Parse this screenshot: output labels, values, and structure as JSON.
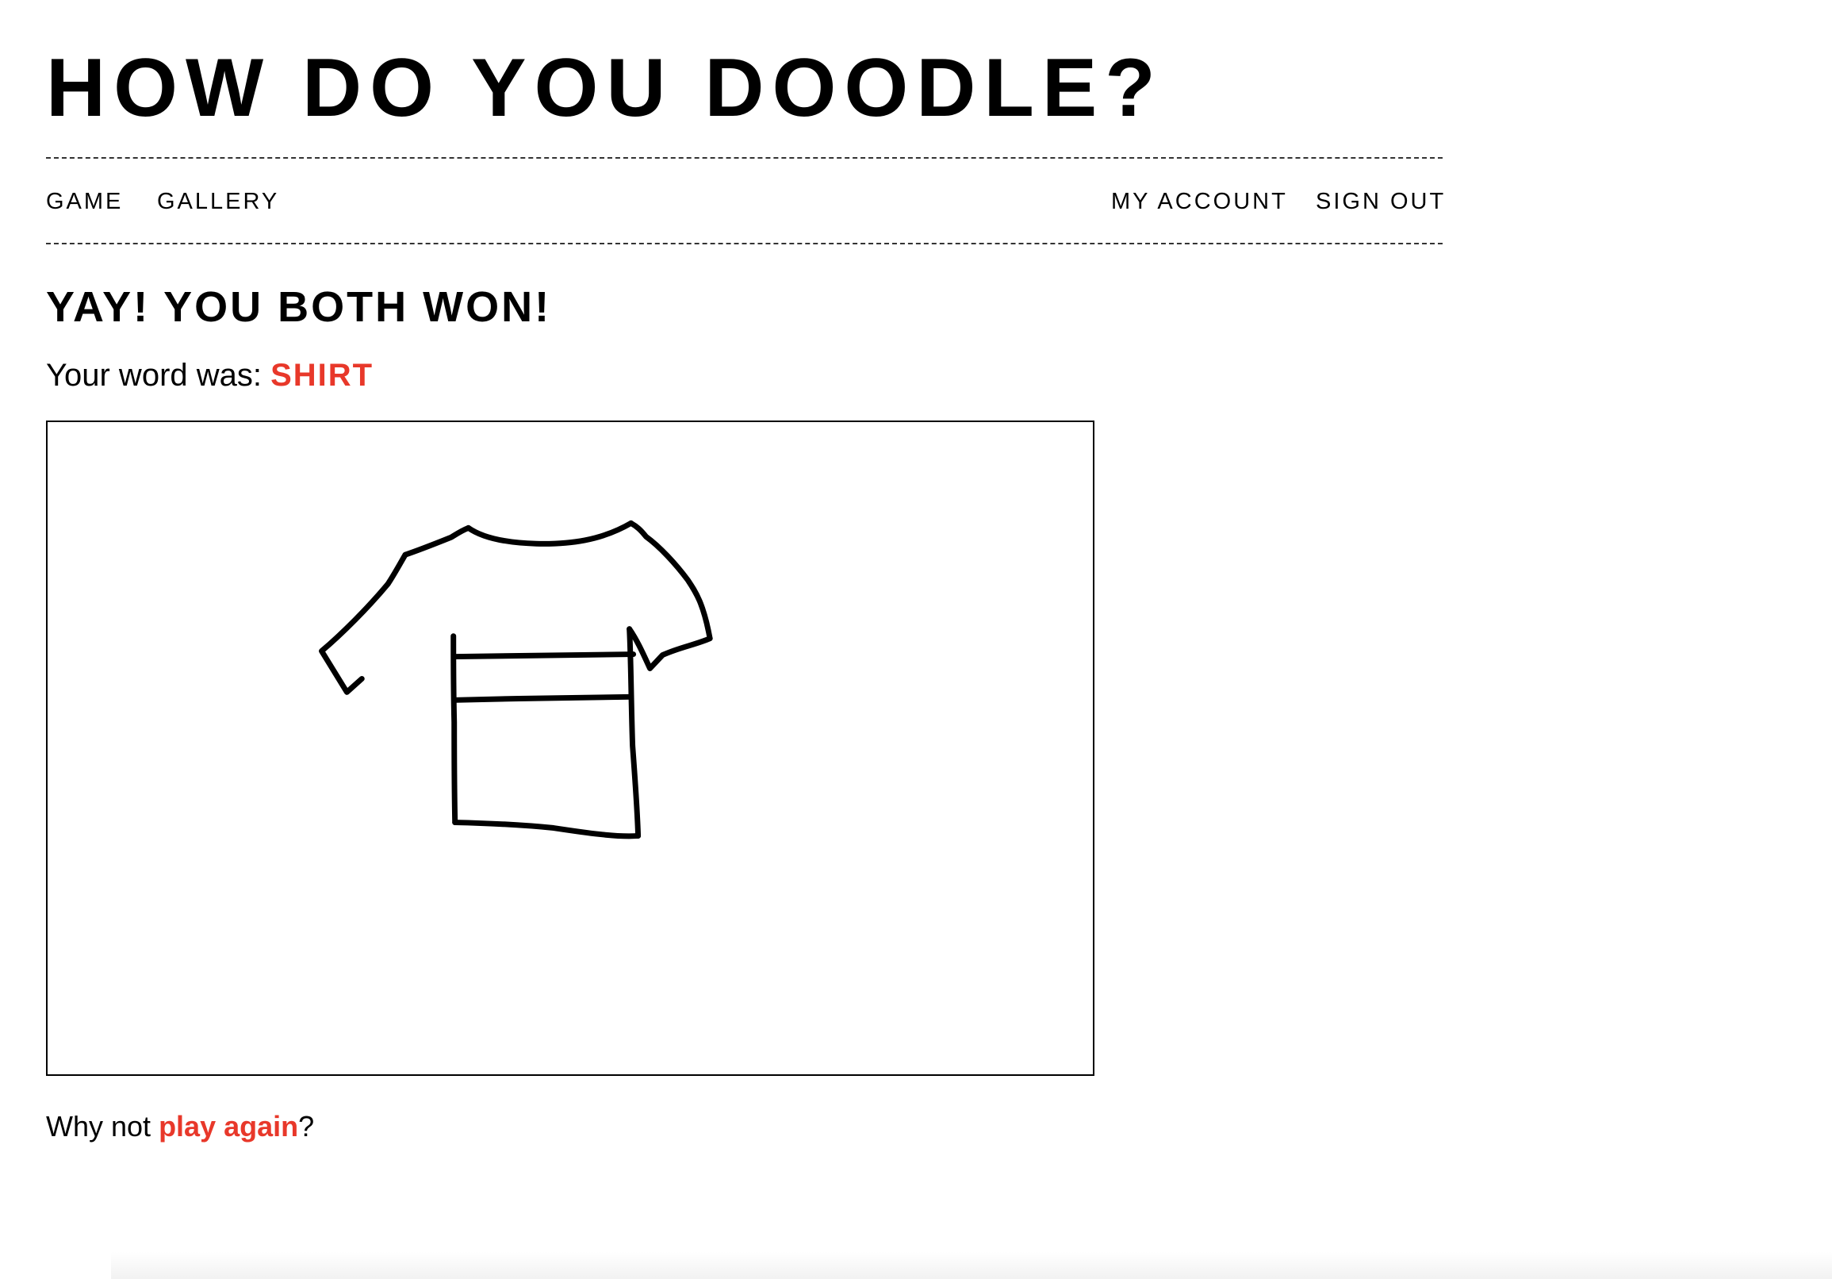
{
  "header": {
    "site_title": "HOW DO YOU DOODLE?"
  },
  "nav": {
    "game": "GAME",
    "gallery": "GALLERY",
    "my_account": "MY ACCOUNT",
    "sign_out": "SIGN OUT"
  },
  "result": {
    "heading": "YAY! YOU BOTH WON!",
    "word_prefix": "Your word was: ",
    "word": "SHIRT"
  },
  "drawing": {
    "subject": "shirt doodle",
    "stroke_color": "#000000"
  },
  "footer": {
    "prefix": "Why not ",
    "link": "play again",
    "suffix": "?"
  },
  "colors": {
    "accent": "#e8382a",
    "text": "#000000",
    "background": "#ffffff"
  }
}
